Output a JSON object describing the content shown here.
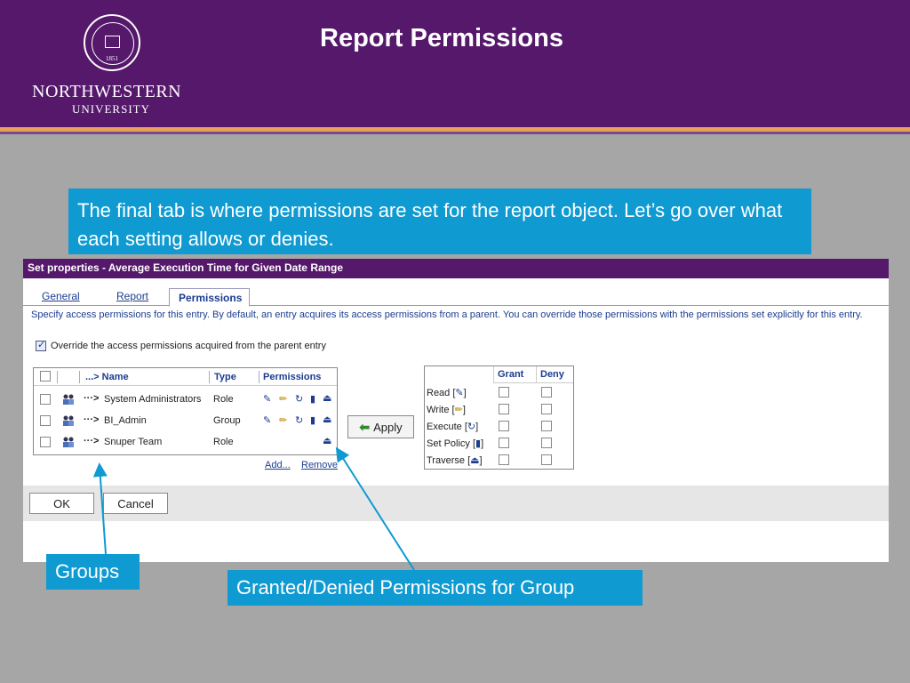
{
  "slide": {
    "title": "Report Permissions",
    "logo": {
      "name": "NORTHWESTERN",
      "sub": "UNIVERSITY",
      "seal_year": "1851"
    }
  },
  "callouts": {
    "intro": "The final tab is where permissions are set for the report object.  Let’s go over what each setting allows or denies.",
    "groups": "Groups",
    "granted": "Granted/Denied Permissions for Group"
  },
  "dialog": {
    "title": "Set properties - Average Execution Time for Given Date Range",
    "tabs": [
      "General",
      "Report",
      "Permissions"
    ],
    "active_tab": "Permissions",
    "description": "Specify access permissions for this entry. By default, an entry acquires its access permissions from a parent. You can override those permissions with the permissions set explicitly for this entry.",
    "override_label": "Override the access permissions acquired from the parent entry",
    "override_checked": true,
    "members_columns": [
      "...> Name",
      "Type",
      "Permissions"
    ],
    "members": [
      {
        "arrow": "···>",
        "name": "System Administrators",
        "type": "Role",
        "perms": [
          "read",
          "write",
          "execute",
          "set-policy",
          "traverse"
        ]
      },
      {
        "arrow": "···>",
        "name": "BI_Admin",
        "type": "Group",
        "perms": [
          "read",
          "write",
          "execute",
          "set-policy",
          "traverse"
        ]
      },
      {
        "arrow": "···>",
        "name": "Snuper Team",
        "type": "Role",
        "perms": [
          "traverse"
        ]
      }
    ],
    "add_label": "Add...",
    "remove_label": "Remove",
    "apply_label": "Apply",
    "gd_columns": [
      "Grant",
      "Deny"
    ],
    "gd_rows": [
      {
        "label": "Read",
        "icon_glyph": "✎",
        "open": "[",
        "close": "]"
      },
      {
        "label": "Write",
        "icon_glyph": "✏",
        "open": "[",
        "close": "]"
      },
      {
        "label": "Execute",
        "icon_glyph": "↻",
        "open": "[",
        "close": "]"
      },
      {
        "label": "Set Policy",
        "icon_glyph": "▮",
        "open": "[",
        "close": "]"
      },
      {
        "label": "Traverse",
        "icon_glyph": "⏏",
        "open": "[",
        "close": "]"
      }
    ],
    "ok_label": "OK",
    "cancel_label": "Cancel"
  },
  "colors": {
    "header_purple": "#55186b",
    "accent_stripe": "#e8a05a",
    "callout_blue": "#0f9ad1",
    "link_blue": "#1b3c8f"
  }
}
